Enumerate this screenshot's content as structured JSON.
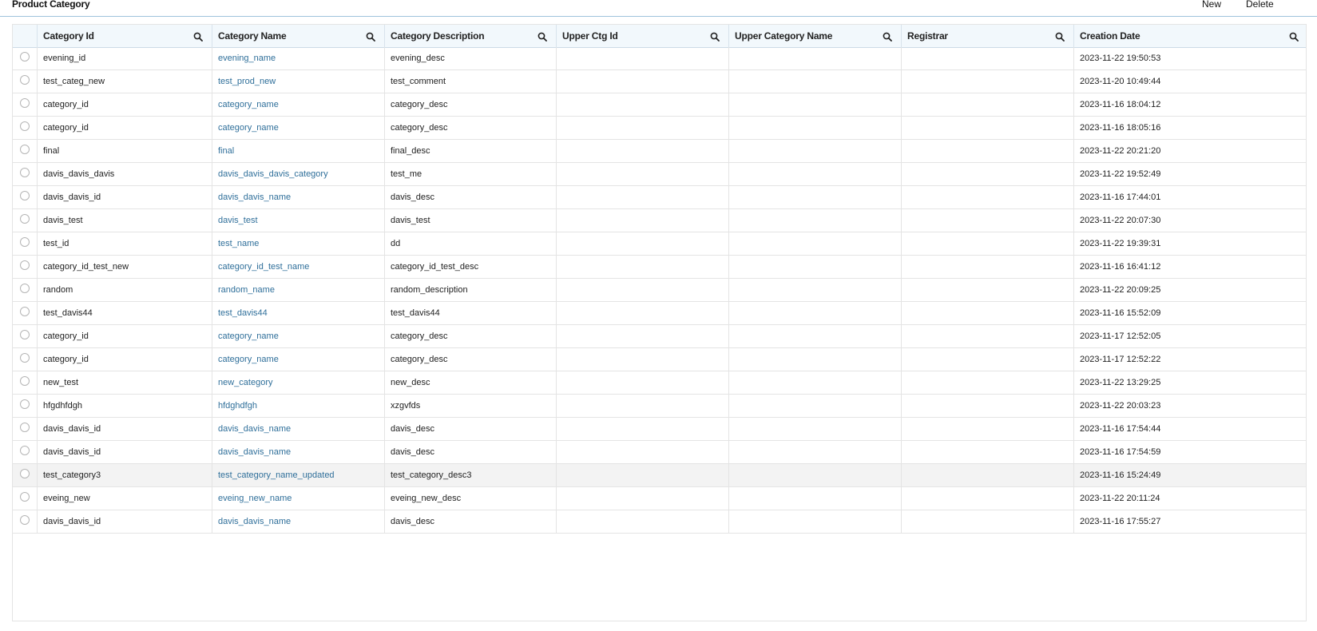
{
  "page": {
    "title": "Product Category"
  },
  "actions": {
    "new_label": "New",
    "delete_label": "Delete"
  },
  "colors": {
    "accent": "#9ec3dc",
    "link": "#2f6f9a",
    "header_bg": "#f2f8fc"
  },
  "columns": [
    {
      "key": "category_id",
      "label": "Category Id",
      "icon": "search-icon"
    },
    {
      "key": "category_name",
      "label": "Category Name",
      "icon": "search-icon"
    },
    {
      "key": "category_description",
      "label": "Category Description",
      "icon": "search-icon"
    },
    {
      "key": "upper_ctg_id",
      "label": "Upper Ctg Id",
      "icon": "search-icon"
    },
    {
      "key": "upper_category_name",
      "label": "Upper Category Name",
      "icon": "search-icon"
    },
    {
      "key": "registrar",
      "label": "Registrar",
      "icon": "search-icon"
    },
    {
      "key": "creation_date",
      "label": "Creation Date",
      "icon": "search-icon"
    }
  ],
  "rows": [
    {
      "category_id": "evening_id",
      "category_name": "evening_name",
      "category_description": "evening_desc",
      "upper_ctg_id": "",
      "upper_category_name": "",
      "registrar": "",
      "creation_date": "2023-11-22 19:50:53"
    },
    {
      "category_id": "test_categ_new",
      "category_name": "test_prod_new",
      "category_description": "test_comment",
      "upper_ctg_id": "",
      "upper_category_name": "",
      "registrar": "",
      "creation_date": "2023-11-20 10:49:44"
    },
    {
      "category_id": "category_id",
      "category_name": "category_name",
      "category_description": "category_desc",
      "upper_ctg_id": "",
      "upper_category_name": "",
      "registrar": "",
      "creation_date": "2023-11-16 18:04:12"
    },
    {
      "category_id": "category_id",
      "category_name": "category_name",
      "category_description": "category_desc",
      "upper_ctg_id": "",
      "upper_category_name": "",
      "registrar": "",
      "creation_date": "2023-11-16 18:05:16"
    },
    {
      "category_id": "final",
      "category_name": "final",
      "category_description": "final_desc",
      "upper_ctg_id": "",
      "upper_category_name": "",
      "registrar": "",
      "creation_date": "2023-11-22 20:21:20"
    },
    {
      "category_id": "davis_davis_davis",
      "category_name": "davis_davis_davis_category",
      "category_description": "test_me",
      "upper_ctg_id": "",
      "upper_category_name": "",
      "registrar": "",
      "creation_date": "2023-11-22 19:52:49"
    },
    {
      "category_id": "davis_davis_id",
      "category_name": "davis_davis_name",
      "category_description": "davis_desc",
      "upper_ctg_id": "",
      "upper_category_name": "",
      "registrar": "",
      "creation_date": "2023-11-16 17:44:01"
    },
    {
      "category_id": "davis_test",
      "category_name": "davis_test",
      "category_description": "davis_test",
      "upper_ctg_id": "",
      "upper_category_name": "",
      "registrar": "",
      "creation_date": "2023-11-22 20:07:30"
    },
    {
      "category_id": "test_id",
      "category_name": "test_name",
      "category_description": "dd",
      "upper_ctg_id": "",
      "upper_category_name": "",
      "registrar": "",
      "creation_date": "2023-11-22 19:39:31"
    },
    {
      "category_id": "category_id_test_new",
      "category_name": "category_id_test_name",
      "category_description": "category_id_test_desc",
      "upper_ctg_id": "",
      "upper_category_name": "",
      "registrar": "",
      "creation_date": "2023-11-16 16:41:12"
    },
    {
      "category_id": "random",
      "category_name": "random_name",
      "category_description": "random_description",
      "upper_ctg_id": "",
      "upper_category_name": "",
      "registrar": "",
      "creation_date": "2023-11-22 20:09:25"
    },
    {
      "category_id": "test_davis44",
      "category_name": "test_davis44",
      "category_description": "test_davis44",
      "upper_ctg_id": "",
      "upper_category_name": "",
      "registrar": "",
      "creation_date": "2023-11-16 15:52:09"
    },
    {
      "category_id": "category_id",
      "category_name": "category_name",
      "category_description": "category_desc",
      "upper_ctg_id": "",
      "upper_category_name": "",
      "registrar": "",
      "creation_date": "2023-11-17 12:52:05"
    },
    {
      "category_id": "category_id",
      "category_name": "category_name",
      "category_description": "category_desc",
      "upper_ctg_id": "",
      "upper_category_name": "",
      "registrar": "",
      "creation_date": "2023-11-17 12:52:22"
    },
    {
      "category_id": "new_test",
      "category_name": "new_category",
      "category_description": "new_desc",
      "upper_ctg_id": "",
      "upper_category_name": "",
      "registrar": "",
      "creation_date": "2023-11-22 13:29:25"
    },
    {
      "category_id": "hfgdhfdgh",
      "category_name": "hfdghdfgh",
      "category_description": "xzgvfds",
      "upper_ctg_id": "",
      "upper_category_name": "",
      "registrar": "",
      "creation_date": "2023-11-22 20:03:23"
    },
    {
      "category_id": "davis_davis_id",
      "category_name": "davis_davis_name",
      "category_description": "davis_desc",
      "upper_ctg_id": "",
      "upper_category_name": "",
      "registrar": "",
      "creation_date": "2023-11-16 17:54:44"
    },
    {
      "category_id": "davis_davis_id",
      "category_name": "davis_davis_name",
      "category_description": "davis_desc",
      "upper_ctg_id": "",
      "upper_category_name": "",
      "registrar": "",
      "creation_date": "2023-11-16 17:54:59"
    },
    {
      "category_id": "test_category3",
      "category_name": "test_category_name_updated",
      "category_description": "test_category_desc3",
      "upper_ctg_id": "",
      "upper_category_name": "",
      "registrar": "",
      "creation_date": "2023-11-16 15:24:49"
    },
    {
      "category_id": "eveing_new",
      "category_name": "eveing_new_name",
      "category_description": "eveing_new_desc",
      "upper_ctg_id": "",
      "upper_category_name": "",
      "registrar": "",
      "creation_date": "2023-11-22 20:11:24"
    },
    {
      "category_id": "davis_davis_id",
      "category_name": "davis_davis_name",
      "category_description": "davis_desc",
      "upper_ctg_id": "",
      "upper_category_name": "",
      "registrar": "",
      "creation_date": "2023-11-16 17:55:27"
    }
  ],
  "highlighted_row": 18
}
